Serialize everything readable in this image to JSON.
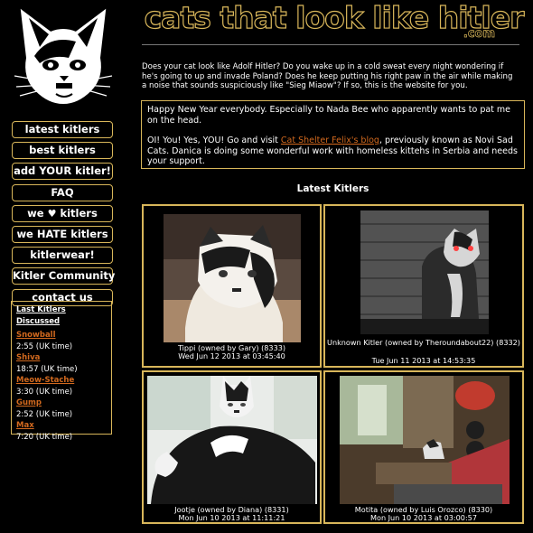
{
  "site": {
    "title": "cats that look like hitler",
    "title_suffix": ".com",
    "intro": "Does your cat look like Adolf Hitler? Do you wake up in a cold sweat every night wondering if he's going to up and invade Poland? Does he keep putting his right paw in the air while making a noise that sounds suspiciously like \"Sieg Miaow\"? If so, this is the website for you."
  },
  "nav": [
    {
      "pre": "latest kitlers",
      "post": ""
    },
    {
      "pre": "best kitlers",
      "post": ""
    },
    {
      "pre": "add YOUR kitler!",
      "post": ""
    },
    {
      "pre": "FAQ",
      "post": ""
    },
    {
      "pre": "we ",
      "post": " kitlers",
      "icon": "heart-icon"
    },
    {
      "pre": "we HATE kitlers",
      "post": ""
    },
    {
      "pre": "kitlerwear!",
      "post": ""
    },
    {
      "pre": "Kitler Community",
      "post": ""
    },
    {
      "pre": "contact us",
      "post": ""
    }
  ],
  "recent": {
    "title": "Last Kitlers Discussed",
    "items": [
      {
        "name": "Snowball",
        "time": "2:55 (UK time)"
      },
      {
        "name": "Shiva",
        "time": "18:57 (UK time)"
      },
      {
        "name": "Meow-Stache",
        "time": "3:30 (UK time)"
      },
      {
        "name": "Gump",
        "time": "2:52 (UK time)"
      },
      {
        "name": "Max",
        "time": "7:20 (UK time)"
      }
    ]
  },
  "news": {
    "line1": "Happy New Year everybody. Especially to Nada Bee who apparently wants to pat me on the head.",
    "line2_before": "OI! You! Yes, YOU! Go and visit ",
    "line2_link": "Cat Shelter Felix's blog",
    "line2_after": ", previously known as Novi Sad Cats. Danica is doing some wonderful work with homeless kittehs in Serbia and needs your support."
  },
  "latest": {
    "heading": "Latest Kitlers",
    "cards": [
      {
        "caption": "Tippi (owned by Gary) (8333)",
        "date": "Wed Jun 12 2013 at 03:45:40"
      },
      {
        "caption": "Unknown Kitler (owned by Theroundabout22) (8332)",
        "date": "Tue Jun 11 2013 at 14:53:35"
      },
      {
        "caption": "Jootje (owned by Diana) (8331)",
        "date": "Mon Jun 10 2013 at 11:11:21"
      },
      {
        "caption": "Motita (owned by Luis Orozco) (8330)",
        "date": "Mon Jun 10 2013 at 03:00:57"
      }
    ]
  },
  "colors": {
    "accent": "#d8b65a",
    "link": "#d2691e",
    "background": "#000000"
  }
}
